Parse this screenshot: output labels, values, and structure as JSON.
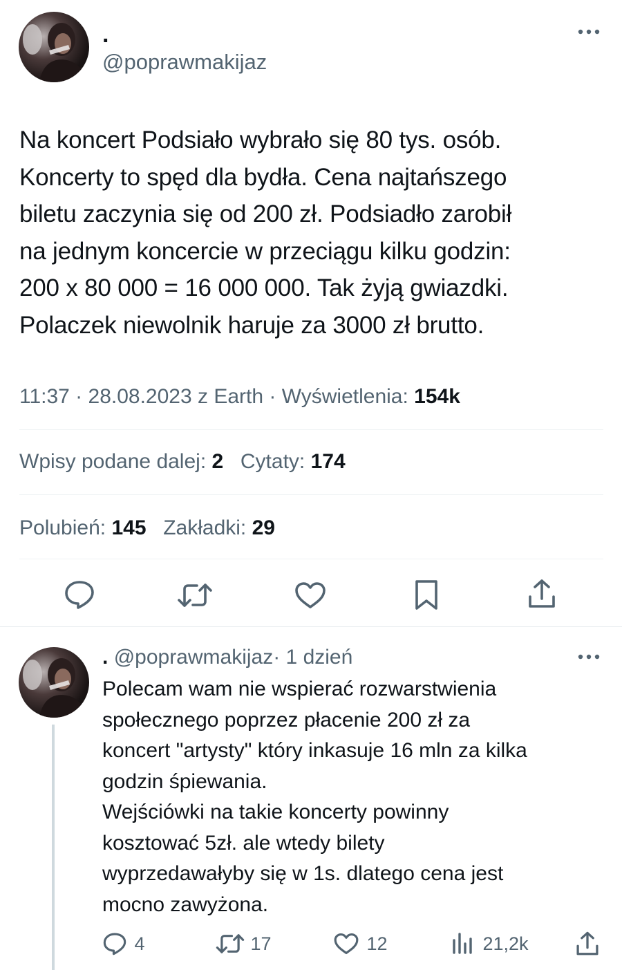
{
  "tweet": {
    "display_name": ".",
    "handle": "@poprawmakijaz",
    "text_lines": [
      "Na koncert Podsiało wybrało się 80 tys. osób.",
      "Koncerty to spęd dla bydła. Cena najtańszego",
      "biletu zaczynia się od 200 zł. Podsiadło zarobił",
      "na jednym koncercie w przeciągu kilku godzin:",
      "200 x 80 000 = 16 000 000. Tak żyją gwiazdki.",
      "Polaczek niewolnik haruje za 3000 zł brutto."
    ],
    "meta": "11:37 · 28.08.2023 z Earth · Wyświetlenia:",
    "views": "154k",
    "stats": {
      "reposts_label": "Wpisy podane dalej:",
      "reposts": "2",
      "quotes_label": "Cytaty:",
      "quotes": "174",
      "likes_label": "Polubień:",
      "likes": "145",
      "bookmarks_label": "Zakładki:",
      "bookmarks": "29"
    }
  },
  "reply": {
    "display_name": ".",
    "handle": "@poprawmakijaz",
    "time": "· 1 dzień",
    "text_lines": [
      "Polecam wam nie wspierać rozwarstwienia",
      "społecznego poprzez płacenie 200 zł za",
      "koncert \"artysty\" który inkasuje 16 mln za kilka",
      "godzin śpiewania.",
      "Wejściówki na takie koncerty powinny",
      "kosztować 5zł. ale wtedy bilety",
      "wyprzedawałyby się w 1s. dlatego cena jest",
      "mocno zawyżona."
    ],
    "actions": {
      "replies": "4",
      "reposts": "17",
      "likes": "12",
      "views": "21,2k"
    }
  },
  "icons": {
    "more": "more-horizontal-icon",
    "reply": "reply-icon",
    "repost": "repost-icon",
    "like": "heart-icon",
    "bookmark": "bookmark-icon",
    "share": "share-icon",
    "views": "views-icon"
  },
  "colors": {
    "text": "#0f1419",
    "muted": "#536471",
    "divider": "#eff3f4",
    "thread_line": "#cfd9de"
  }
}
